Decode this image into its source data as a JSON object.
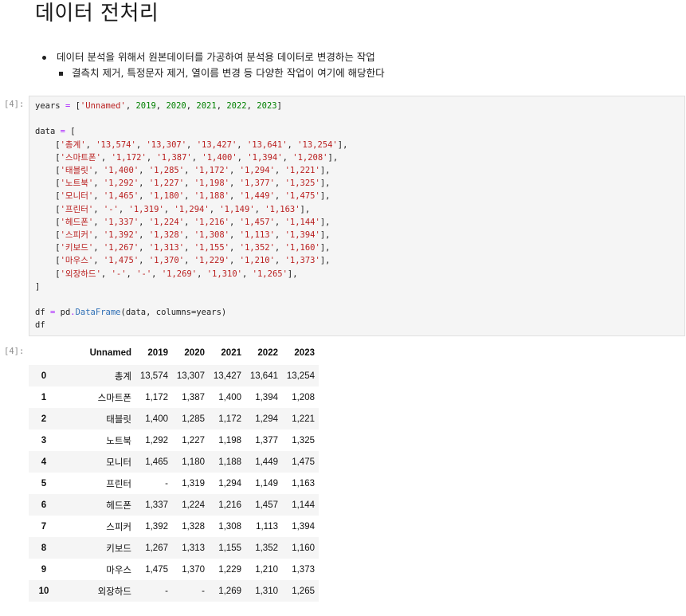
{
  "markdown": {
    "title": "데이터 전처리",
    "bullet": "데이터 분석을 위해서 원본데이터를 가공하여 분석용 데이터로 변경하는 작업",
    "sub_bullet": "결측치 제거, 특정문자 제거, 열이름 변경 등 다양한 작업이 여기에 해당한다"
  },
  "code_cell": {
    "prompt": "[4]:",
    "years_line": {
      "var": "years",
      "items": [
        "'Unnamed'",
        "2019",
        "2020",
        "2021",
        "2022",
        "2023"
      ]
    },
    "data_var": "data",
    "rows": [
      [
        "'총계'",
        "'13,574'",
        "'13,307'",
        "'13,427'",
        "'13,641'",
        "'13,254'"
      ],
      [
        "'스마트폰'",
        "'1,172'",
        "'1,387'",
        "'1,400'",
        "'1,394'",
        "'1,208'"
      ],
      [
        "'태블릿'",
        "'1,400'",
        "'1,285'",
        "'1,172'",
        "'1,294'",
        "'1,221'"
      ],
      [
        "'노트북'",
        "'1,292'",
        "'1,227'",
        "'1,198'",
        "'1,377'",
        "'1,325'"
      ],
      [
        "'모니터'",
        "'1,465'",
        "'1,180'",
        "'1,188'",
        "'1,449'",
        "'1,475'"
      ],
      [
        "'프린터'",
        "'-'",
        "'1,319'",
        "'1,294'",
        "'1,149'",
        "'1,163'"
      ],
      [
        "'헤드폰'",
        "'1,337'",
        "'1,224'",
        "'1,216'",
        "'1,457'",
        "'1,144'"
      ],
      [
        "'스피커'",
        "'1,392'",
        "'1,328'",
        "'1,308'",
        "'1,113'",
        "'1,394'"
      ],
      [
        "'키보드'",
        "'1,267'",
        "'1,313'",
        "'1,155'",
        "'1,352'",
        "'1,160'"
      ],
      [
        "'마우스'",
        "'1,475'",
        "'1,370'",
        "'1,229'",
        "'1,210'",
        "'1,373'"
      ],
      [
        "'외장하드'",
        "'-'",
        "'-'",
        "'1,269'",
        "'1,310'",
        "'1,265'"
      ]
    ],
    "df_line": {
      "var": "df",
      "obj": "pd",
      "func": "DataFrame",
      "args": "(data, columns=years)"
    },
    "last_line": "df"
  },
  "output_cell": {
    "prompt": "[4]:",
    "columns": [
      "Unnamed",
      "2019",
      "2020",
      "2021",
      "2022",
      "2023"
    ],
    "index": [
      "0",
      "1",
      "2",
      "3",
      "4",
      "5",
      "6",
      "7",
      "8",
      "9",
      "10"
    ],
    "rows": [
      [
        "총계",
        "13,574",
        "13,307",
        "13,427",
        "13,641",
        "13,254"
      ],
      [
        "스마트폰",
        "1,172",
        "1,387",
        "1,400",
        "1,394",
        "1,208"
      ],
      [
        "태블릿",
        "1,400",
        "1,285",
        "1,172",
        "1,294",
        "1,221"
      ],
      [
        "노트북",
        "1,292",
        "1,227",
        "1,198",
        "1,377",
        "1,325"
      ],
      [
        "모니터",
        "1,465",
        "1,180",
        "1,188",
        "1,449",
        "1,475"
      ],
      [
        "프린터",
        "-",
        "1,319",
        "1,294",
        "1,149",
        "1,163"
      ],
      [
        "헤드폰",
        "1,337",
        "1,224",
        "1,216",
        "1,457",
        "1,144"
      ],
      [
        "스피커",
        "1,392",
        "1,328",
        "1,308",
        "1,113",
        "1,394"
      ],
      [
        "키보드",
        "1,267",
        "1,313",
        "1,155",
        "1,352",
        "1,160"
      ],
      [
        "마우스",
        "1,475",
        "1,370",
        "1,229",
        "1,210",
        "1,373"
      ],
      [
        "외장하드",
        "-",
        "-",
        "1,269",
        "1,310",
        "1,265"
      ]
    ]
  },
  "colors": {
    "string": "#ba2121",
    "number": "#008000",
    "operator": "#aa22ff",
    "function": "#2f6fb5",
    "cell_bg": "#f5f5f5"
  }
}
